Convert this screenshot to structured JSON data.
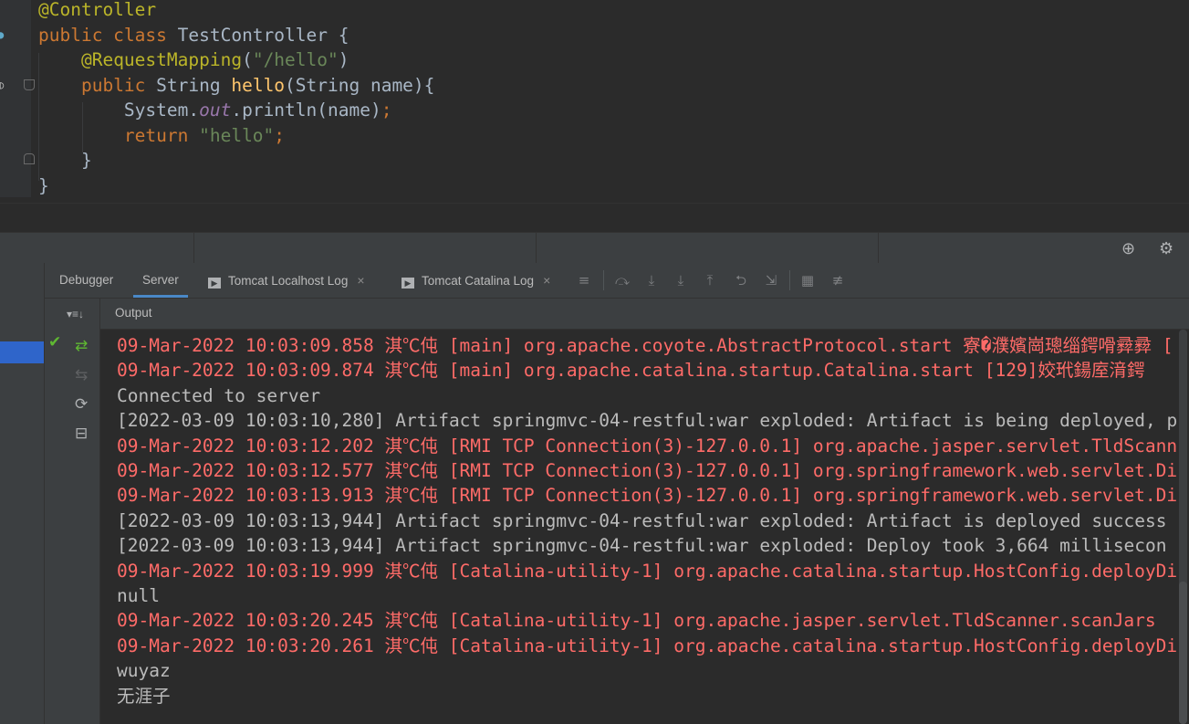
{
  "editor": {
    "lines": [
      {
        "parts": [
          {
            "c": "ann",
            "t": "@Controller"
          }
        ]
      },
      {
        "parts": [
          {
            "c": "kw",
            "t": "public class "
          },
          {
            "c": "",
            "t": "TestController {"
          }
        ]
      },
      {
        "parts": [
          {
            "c": "",
            "t": "    "
          },
          {
            "c": "ann",
            "t": "@RequestMapping"
          },
          {
            "c": "",
            "t": "("
          },
          {
            "c": "str",
            "t": "\"/hello\""
          },
          {
            "c": "",
            "t": ")"
          }
        ]
      },
      {
        "parts": [
          {
            "c": "",
            "t": "    "
          },
          {
            "c": "kw",
            "t": "public "
          },
          {
            "c": "",
            "t": "String "
          },
          {
            "c": "fn",
            "t": "hello"
          },
          {
            "c": "",
            "t": "(String name){"
          }
        ]
      },
      {
        "parts": [
          {
            "c": "",
            "t": "        System."
          },
          {
            "c": "fld",
            "t": "out"
          },
          {
            "c": "",
            "t": ".println(name)"
          },
          {
            "c": "kw",
            "t": ";"
          }
        ]
      },
      {
        "parts": [
          {
            "c": "",
            "t": "        "
          },
          {
            "c": "kw",
            "t": "return "
          },
          {
            "c": "str",
            "t": "\"hello\""
          },
          {
            "c": "kw",
            "t": ";"
          }
        ]
      },
      {
        "parts": [
          {
            "c": "",
            "t": "    }"
          }
        ]
      },
      {
        "parts": [
          {
            "c": "",
            "t": "}"
          }
        ]
      }
    ]
  },
  "tabs": {
    "debugger": "Debugger",
    "server": "Server",
    "localhost_log": "Tomcat Localhost Log",
    "catalina_log": "Tomcat Catalina Log",
    "close_glyph": "×",
    "log_icon_glyph": "▶"
  },
  "toolbar": {
    "layout_icon_glyph": "≡",
    "step_over_glyph": "⤼",
    "step_into_glyph": "⤓",
    "force_step_into_glyph": "⤓",
    "step_out_glyph": "⤒",
    "drop_frame_glyph": "⮌",
    "run_to_cursor_glyph": "⇲",
    "evaluate_glyph": "▦",
    "trace_glyph": "≢"
  },
  "header_icons": {
    "target_glyph": "⊕",
    "settings_glyph": "⚙"
  },
  "output_label": "Output",
  "threads_dropdown": "▾≡↓",
  "actions": {
    "check_glyph": "✔",
    "deploy_glyph": "⇄",
    "undeploy_glyph": "⇆",
    "refresh_glyph": "⟳",
    "update_glyph": "⊟"
  },
  "colors": {
    "error_text": "#ff6b68",
    "normal_text": "#bbbbbb",
    "selection": "#2f65ca",
    "accent": "#4a88c7"
  },
  "console": [
    {
      "type": "err",
      "text": "09-Mar-2022 10:03:09.858 淇℃伅 [main] org.apache.coyote.AbstractProtocol.start 寮�濮嬪崗璁缁鍔嗗彛彛 ["
    },
    {
      "type": "err",
      "text": "09-Mar-2022 10:03:09.874 淇℃伅 [main] org.apache.catalina.startup.Catalina.start [129]姣玳鍚庢湇鍔"
    },
    {
      "type": "std",
      "text": "Connected to server"
    },
    {
      "type": "std",
      "text": "[2022-03-09 10:03:10,280] Artifact springmvc-04-restful:war exploded: Artifact is being deployed, p"
    },
    {
      "type": "err",
      "text": "09-Mar-2022 10:03:12.202 淇℃伅 [RMI TCP Connection(3)-127.0.0.1] org.apache.jasper.servlet.TldScann"
    },
    {
      "type": "err",
      "text": "09-Mar-2022 10:03:12.577 淇℃伅 [RMI TCP Connection(3)-127.0.0.1] org.springframework.web.servlet.Dis"
    },
    {
      "type": "err",
      "text": "09-Mar-2022 10:03:13.913 淇℃伅 [RMI TCP Connection(3)-127.0.0.1] org.springframework.web.servlet.Dis"
    },
    {
      "type": "std",
      "text": "[2022-03-09 10:03:13,944] Artifact springmvc-04-restful:war exploded: Artifact is deployed success"
    },
    {
      "type": "std",
      "text": "[2022-03-09 10:03:13,944] Artifact springmvc-04-restful:war exploded: Deploy took 3,664 millisecon"
    },
    {
      "type": "err",
      "text": "09-Mar-2022 10:03:19.999 淇℃伅 [Catalina-utility-1] org.apache.catalina.startup.HostConfig.deployDi"
    },
    {
      "type": "std",
      "text": "null"
    },
    {
      "type": "err",
      "text": "09-Mar-2022 10:03:20.245 淇℃伅 [Catalina-utility-1] org.apache.jasper.servlet.TldScanner.scanJars"
    },
    {
      "type": "err",
      "text": "09-Mar-2022 10:03:20.261 淇℃伅 [Catalina-utility-1] org.apache.catalina.startup.HostConfig.deployDi"
    },
    {
      "type": "std",
      "text": "wuyaz"
    },
    {
      "type": "std",
      "text": "无涯子"
    }
  ]
}
